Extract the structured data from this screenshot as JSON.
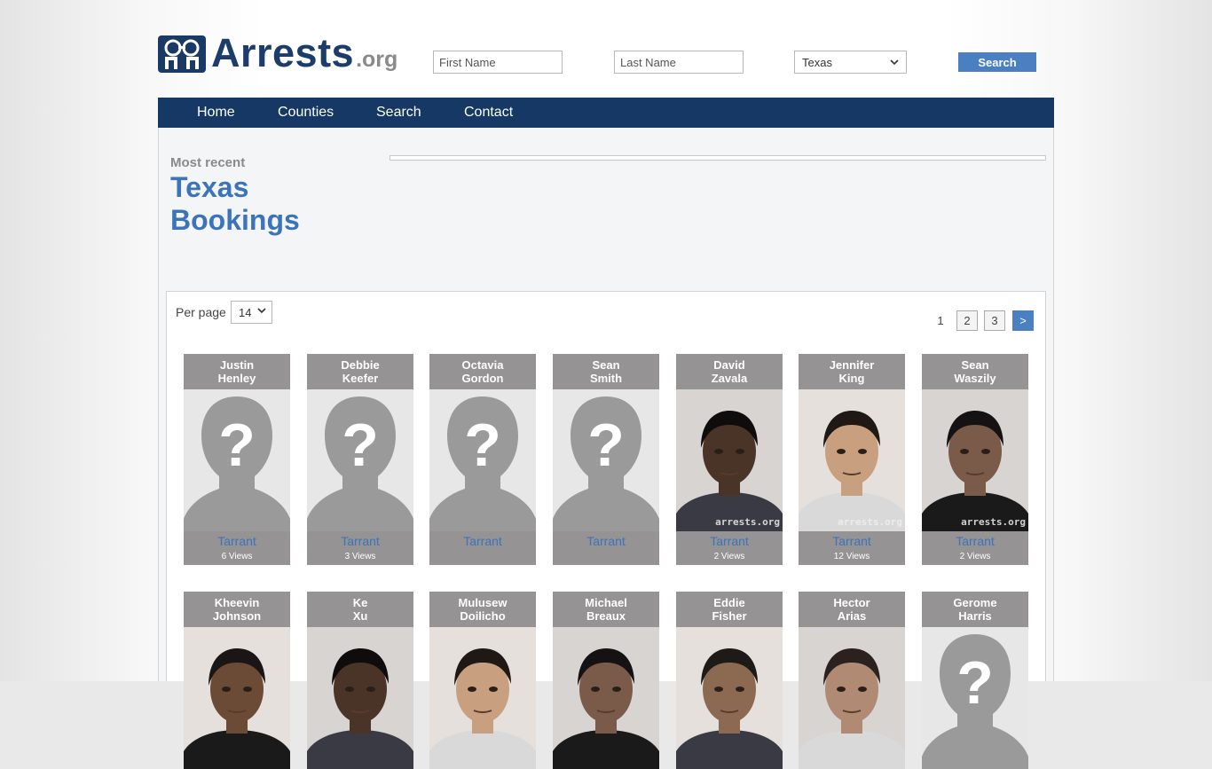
{
  "brand": {
    "name": "Arrests",
    "tld": ".org"
  },
  "search": {
    "first_name_placeholder": "First Name",
    "last_name_placeholder": "Last Name",
    "state_selected": "Texas",
    "button_label": "Search"
  },
  "nav": [
    "Home",
    "Counties",
    "Search",
    "Contact"
  ],
  "intro": {
    "kicker": "Most recent",
    "title_line1": "Texas",
    "title_line2": "Bookings"
  },
  "list_controls": {
    "per_page_label": "Per page",
    "per_page_value": "14",
    "pages": [
      "1",
      "2",
      "3"
    ],
    "next_label": ">"
  },
  "watermark": "arrests.org",
  "cards_row1": [
    {
      "first": "Justin",
      "last": "Henley",
      "county": "Tarrant",
      "views": "6 Views",
      "photo": "placeholder"
    },
    {
      "first": "Debbie",
      "last": "Keefer",
      "county": "Tarrant",
      "views": "3 Views",
      "photo": "placeholder"
    },
    {
      "first": "Octavia",
      "last": "Gordon",
      "county": "Tarrant",
      "views": "",
      "photo": "placeholder"
    },
    {
      "first": "Sean",
      "last": "Smith",
      "county": "Tarrant",
      "views": "",
      "photo": "placeholder"
    },
    {
      "first": "David",
      "last": "Zavala",
      "county": "Tarrant",
      "views": "2 Views",
      "photo": "mugshot"
    },
    {
      "first": "Jennifer",
      "last": "King",
      "county": "Tarrant",
      "views": "12 Views",
      "photo": "mugshot"
    },
    {
      "first": "Sean",
      "last": "Waszily",
      "county": "Tarrant",
      "views": "2 Views",
      "photo": "mugshot"
    }
  ],
  "cards_row2": [
    {
      "first": "Kheevin",
      "last": "Johnson",
      "photo": "mugshot"
    },
    {
      "first": "Ke",
      "last": "Xu",
      "photo": "mugshot"
    },
    {
      "first": "Mulusew",
      "last": "Doilicho",
      "photo": "mugshot"
    },
    {
      "first": "Michael",
      "last": "Breaux",
      "photo": "mugshot"
    },
    {
      "first": "Eddie",
      "last": "Fisher",
      "photo": "mugshot"
    },
    {
      "first": "Hector",
      "last": "Arias",
      "photo": "mugshot"
    },
    {
      "first": "Gerome",
      "last": "Harris",
      "photo": "placeholder"
    }
  ],
  "colors": {
    "navy": "#153865",
    "accent": "#3b74bb",
    "button": "#4a7fc1",
    "card": "#959393"
  }
}
